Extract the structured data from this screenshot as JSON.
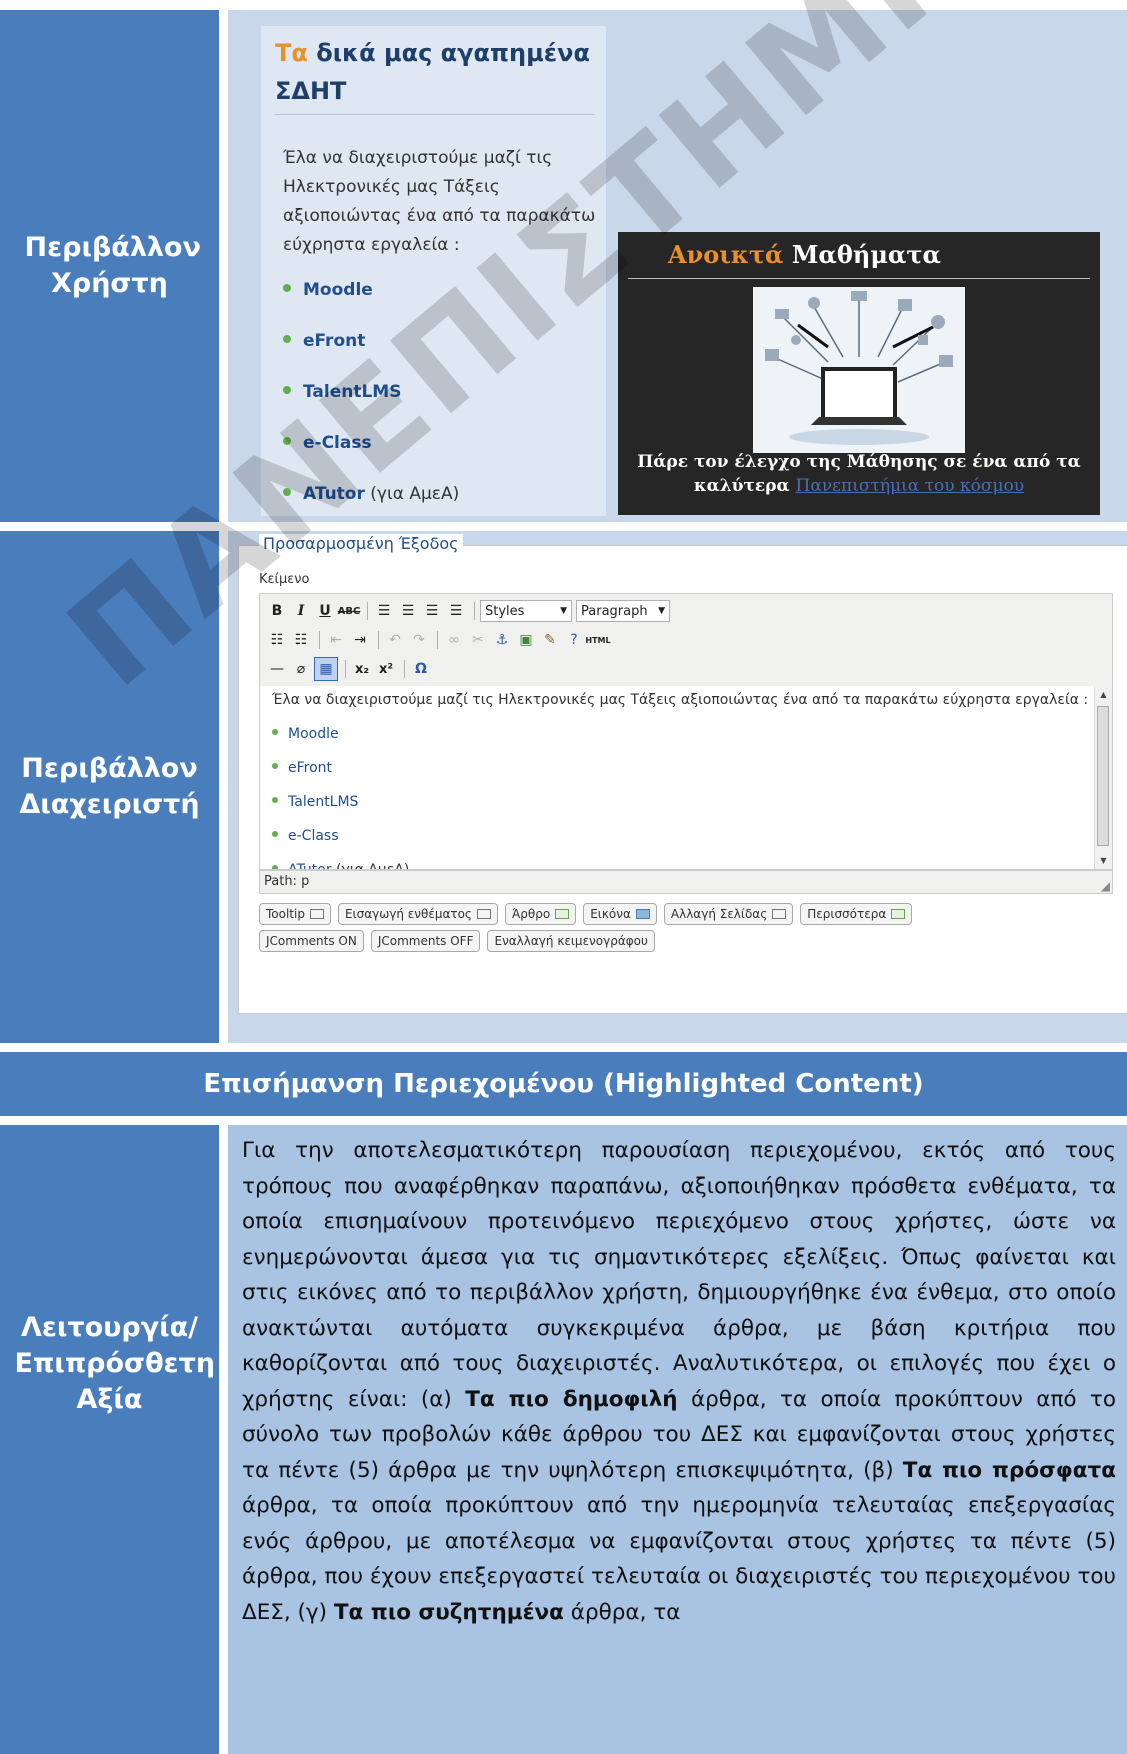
{
  "rows": {
    "user_env_label": "Περιβάλλον Χρήστη",
    "admin_env_label": "Περιβάλλον Διαχειριστή",
    "function_label": "Λειτουργία/ Επιπρόσθετη Αξία"
  },
  "favorites": {
    "title_accent": "Τα",
    "title_rest": " δικά μας αγαπημένα ΣΔΗΤ",
    "intro": "Έλα να διαχειριστούμε μαζί τις Ηλεκτρονικές μας Τάξεις αξιοποιώντας ένα από τα παρακάτω εύχρηστα εργαλεία :",
    "items": [
      "Moodle",
      "eFront",
      "TalentLMS",
      "e-Class",
      "ATutor"
    ],
    "atutor_note": " (για ΑμεΑ)"
  },
  "open_courses": {
    "title_accent": "Ανοικτά",
    "title_rest": " Μαθήματα",
    "caption": "Πάρε τον έλεγχο της Μάθησης σε ένα από τα καλύτερα ",
    "caption_link": "Πανεπιστήμια του κόσμου"
  },
  "admin": {
    "legend": "Προσαρμοσμένη Έξοδος",
    "field_label": "Κείμενο",
    "styles_select": "Styles",
    "format_select": "Paragraph",
    "editor_intro": "Έλα να διαχειριστούμε μαζί τις Ηλεκτρονικές μας Τάξεις αξιοποιώντας ένα από τα παρακάτω εύχρηστα εργαλεία :",
    "editor_items": [
      "Moodle",
      "eFront",
      "TalentLMS",
      "e-Class",
      "ATutor"
    ],
    "atutor_note": " (για ΑμεΑ)",
    "path": "Path: p",
    "buttons_row1": [
      "Tooltip",
      "Εισαγωγή ενθέματος",
      "Άρθρο",
      "Εικόνα",
      "Αλλαγή Σελίδας",
      "Περισσότερα"
    ],
    "buttons_row2": [
      "JComments ON",
      "JComments OFF",
      "Εναλλαγή κειμενογράφου"
    ],
    "html_button": "HTML"
  },
  "section_header": "Επισήμανση Περιεχομένου (Highlighted Content)",
  "body": {
    "p1": "Για την αποτελεσματικότερη παρουσίαση περιεχομένου, εκτός από τους τρόπους που αναφέρθηκαν παραπάνω, αξιοποιήθηκαν πρόσθετα ενθέματα, τα οποία επισημαίνουν προτεινόμενο περιεχόμενο στους χρήστες, ώστε να ενημερώνονται άμεσα για τις σημαντικότερες εξελίξεις. Όπως φαίνεται και στις εικόνες από το περιβάλλον χρήστη, δημιουργήθηκε ένα ένθεμα, στο οποίο ανακτώνται αυτόματα συγκεκριμένα άρθρα, με βάση κριτήρια που καθορίζονται από τους διαχειριστές. Αναλυτικότερα, οι επιλογές που έχει ο χρήστης είναι: (α) ",
    "b1": "Τα πιο δημοφιλή",
    "p2": " άρθρα, τα οποία προκύπτουν από το σύνολο των προβολών κάθε άρθρου του ΔΕΣ και εμφανίζονται στους χρήστες τα πέντε (5) άρθρα με την υψηλότερη επισκεψιμότητα, (β) ",
    "b2": "Τα πιο πρόσφατα",
    "p3": " άρθρα, τα οποία προκύπτουν από την ημερομηνία τελευταίας επεξεργασίας ενός άρθρου, με αποτέλεσμα να εμφανίζονται στους χρήστες τα πέντε (5) άρθρα, που έχουν επεξεργαστεί τελευταία οι διαχειριστές του περιεχομένου του ΔΕΣ, (γ) ",
    "b3": "Τα πιο συζητημένα",
    "p4": " άρθρα, τα"
  },
  "watermark": "ΠΑΝΕΠΙΣΤΗΜΙΟ ΠΕΙΡΑΙΩΣ",
  "colors": {
    "label_blue": "#4a7dbc",
    "content_light": "#c9d7ea",
    "content_body": "#a9c3e2",
    "accent_orange": "#e8912c",
    "bullet_green": "#5fb14d"
  }
}
